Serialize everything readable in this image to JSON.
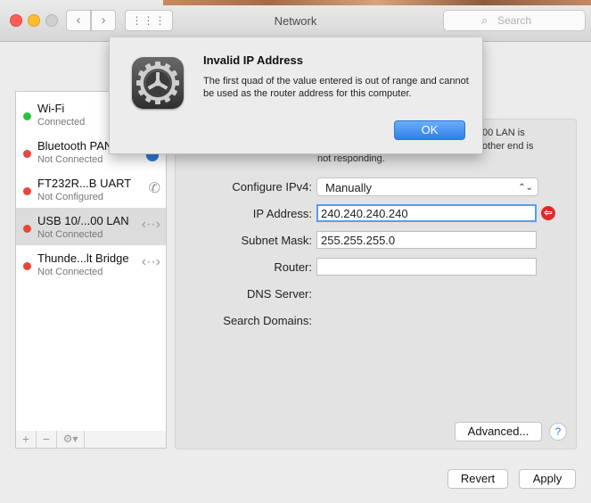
{
  "window": {
    "title": "Network"
  },
  "toolbar": {
    "search_placeholder": "Search",
    "back": "‹",
    "forward": "›",
    "grid": "⋮⋮⋮"
  },
  "sidebar": {
    "services": [
      {
        "name": "Wi-Fi",
        "status": "Connected"
      },
      {
        "name": "Bluetooth PAN",
        "status": "Not Connected"
      },
      {
        "name": "FT232R...B UART",
        "status": "Not Configured"
      },
      {
        "name": "USB 10/...00 LAN",
        "status": "Not Connected"
      },
      {
        "name": "Thunde...lt Bridge",
        "status": "Not Connected"
      }
    ],
    "add_label": "+",
    "remove_label": "−",
    "gear_label": "⚙▾"
  },
  "panel": {
    "status_line1": "00 LAN is",
    "status_line2": "other end is",
    "status_line3": "not responding.",
    "configure_label": "Configure IPv4:",
    "configure_value": "Manually",
    "ip_label": "IP Address:",
    "ip_value": "240.240.240.240",
    "subnet_label": "Subnet Mask:",
    "subnet_value": "255.255.255.0",
    "router_label": "Router:",
    "router_value": "",
    "dns_label": "DNS Server:",
    "search_domains_label": "Search Domains:",
    "advanced_label": "Advanced...",
    "help_label": "?"
  },
  "footer": {
    "revert_label": "Revert",
    "apply_label": "Apply"
  },
  "dialog": {
    "title": "Invalid IP Address",
    "message": "The first quad of the value entered is out of range and cannot be used as the router address for this computer.",
    "ok_label": "OK"
  },
  "colors": {
    "accent": "#2f7fe9",
    "connected": "#29c33a",
    "disconnected": "#e8453c",
    "error": "#e02a2a"
  }
}
